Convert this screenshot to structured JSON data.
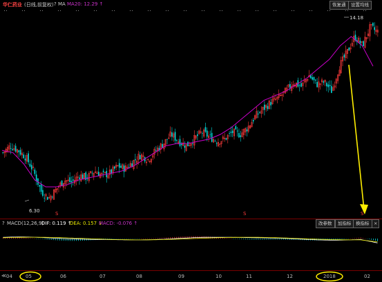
{
  "header": {
    "stock_name": "华仁药业",
    "period_label": "(日线,前复权)",
    "ma_indicator_symbol": "MA",
    "ma_label": "MA20: 12.29 ↑",
    "btn_restore": "恢复通",
    "btn_settings": "设置均线"
  },
  "price_chart": {
    "high_label": "14.18",
    "low_label": "6.30",
    "event_marks": [
      "S",
      "S",
      "S"
    ]
  },
  "macd": {
    "question_mark": "?",
    "name": "MACD(12,26,9)",
    "dif": "DIF: 0.119 ↑",
    "dea": "DEA: 0.157 ↓",
    "macd_val": "MACD: -0.076 ↑",
    "btn_params": "改参数",
    "btn_add": "加指标",
    "btn_switch": "换指标",
    "btn_close": "×"
  },
  "xaxis": {
    "nav_left": "≪",
    "labels": [
      "04",
      "05",
      "06",
      "07",
      "08",
      "09",
      "10",
      "11",
      "12",
      "2018",
      "02"
    ]
  },
  "colors": {
    "up": "#ff3c3c",
    "down": "#00dcdc",
    "ma20": "#cc00cc",
    "dif": "#ffffff",
    "dea": "#e8e800",
    "annotation": "#ffee00",
    "title": "#ff4444"
  },
  "chart_data": {
    "type": "candlestick",
    "title": "华仁药业 (日线,前复权)",
    "x_labels": [
      "04",
      "05",
      "06",
      "07",
      "08",
      "09",
      "10",
      "11",
      "12",
      "2018",
      "02"
    ],
    "close_path": [
      8.5,
      8.8,
      8.6,
      8.3,
      7.7,
      6.8,
      6.5,
      6.9,
      7.3,
      7.2,
      7.5,
      7.4,
      7.7,
      7.5,
      7.6,
      7.9,
      7.8,
      8.1,
      8.4,
      8.2,
      8.6,
      8.9,
      9.3,
      9.0,
      8.8,
      9.1,
      9.4,
      9.2,
      9.0,
      9.1,
      9.4,
      9.3,
      9.6,
      10.1,
      10.4,
      10.7,
      10.9,
      11.2,
      11.6,
      11.4,
      11.9,
      11.5,
      11.6,
      11.2,
      12.3,
      12.9,
      13.6,
      13.2,
      14.0,
      13.8
    ],
    "ma20_path": [
      8.6,
      8.5,
      8.0,
      7.3,
      7.0,
      7.0,
      7.1,
      7.3,
      7.4,
      7.5,
      7.6,
      7.7,
      7.9,
      8.2,
      8.5,
      8.8,
      8.9,
      8.9,
      9.0,
      9.1,
      9.3,
      9.6,
      10.0,
      10.4,
      10.8,
      11.0,
      11.2,
      11.5,
      11.8,
      12.2,
      12.6,
      13.2,
      13.6,
      13.2,
      12.3
    ],
    "high": 14.18,
    "low": 6.3,
    "ma20_current": 12.29,
    "macd": {
      "dif": 0.119,
      "dea": 0.157,
      "macd": -0.076
    }
  }
}
